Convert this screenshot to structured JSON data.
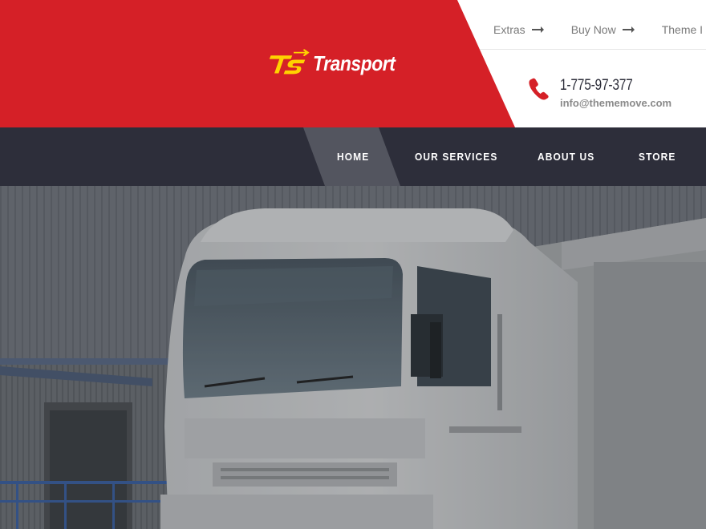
{
  "brand": {
    "name": "Transport",
    "mark": "TS",
    "primary_color": "#d52027",
    "dark_color": "#2d2e3a",
    "logo_accent_color": "#ffd200"
  },
  "top_links": [
    {
      "label": "Extras",
      "icon": "arrow-right-icon"
    },
    {
      "label": "Buy Now",
      "icon": "arrow-right-icon"
    },
    {
      "label": "Theme I",
      "icon": "arrow-right-icon"
    }
  ],
  "contact": {
    "icon": "phone-icon",
    "phone": "1-775-97-377",
    "email": "info@thememove.com"
  },
  "nav": {
    "items": [
      {
        "label": "HOME",
        "active": true
      },
      {
        "label": "OUR SERVICES",
        "active": false
      },
      {
        "label": "ABOUT US",
        "active": false
      },
      {
        "label": "STORE",
        "active": false
      }
    ]
  },
  "hero": {
    "image": "white-truck-photo"
  }
}
